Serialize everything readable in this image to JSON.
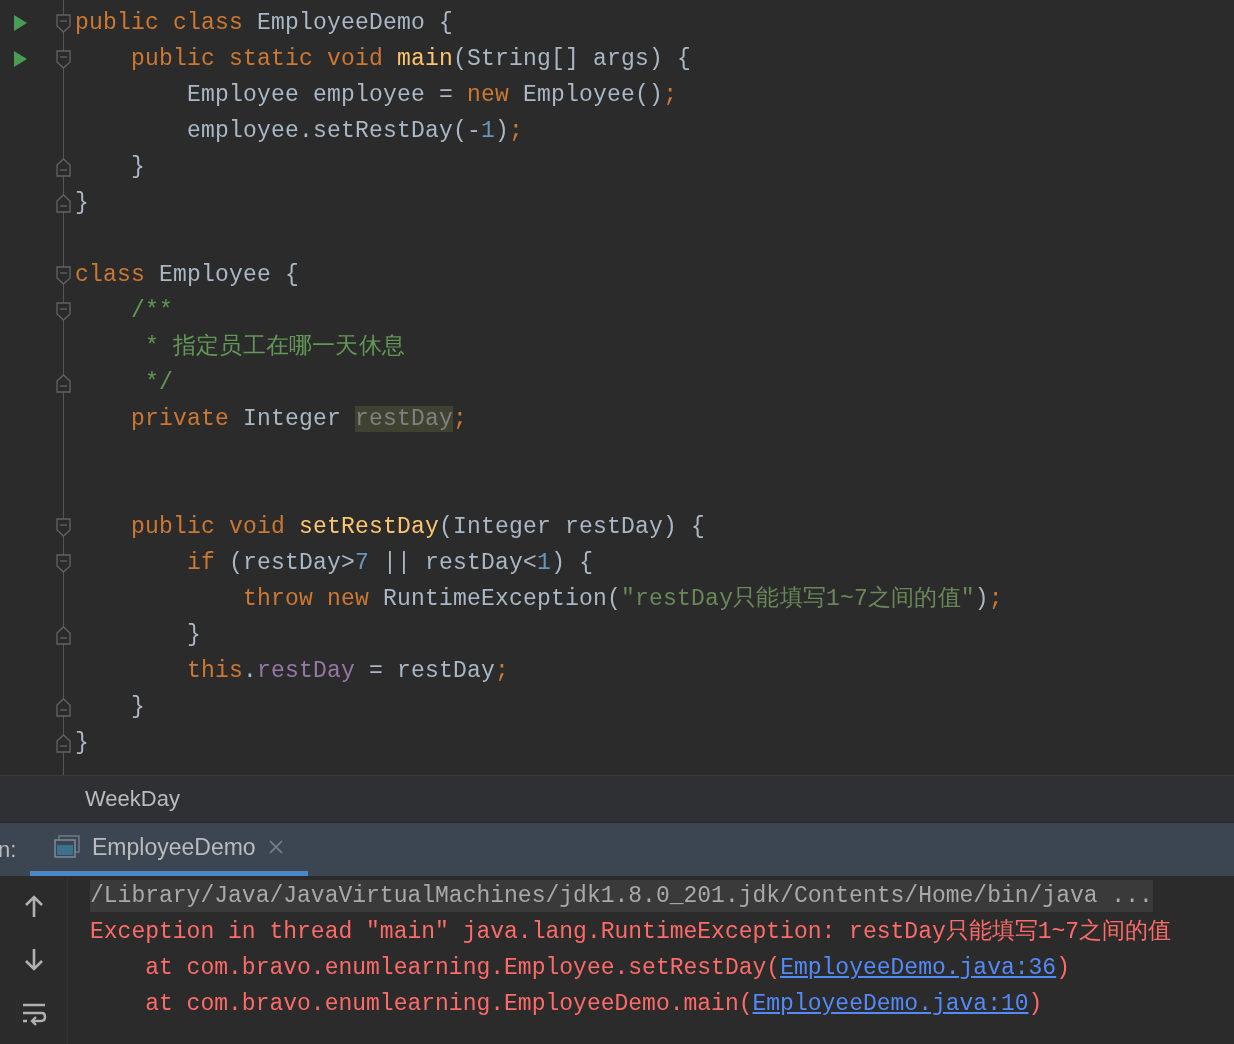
{
  "editor": {
    "lines": [
      {
        "run": true,
        "fold_start": true,
        "fold_end": false,
        "tokens": [
          {
            "kind": "keyword",
            "text": "public class "
          },
          {
            "kind": "plain",
            "text": "EmployeeDemo {"
          }
        ]
      },
      {
        "run": true,
        "fold_start": true,
        "fold_end": false,
        "tokens": [
          {
            "kind": "keyword",
            "text": "    public static void "
          },
          {
            "kind": "method",
            "text": "main"
          },
          {
            "kind": "plain",
            "text": "(String[] args) {"
          }
        ]
      },
      {
        "run": false,
        "fold_start": false,
        "fold_end": false,
        "tokens": [
          {
            "kind": "plain",
            "text": "        Employee employee = "
          },
          {
            "kind": "keyword",
            "text": "new "
          },
          {
            "kind": "plain",
            "text": "Employee()"
          },
          {
            "kind": "keyword",
            "text": ";"
          }
        ]
      },
      {
        "run": false,
        "fold_start": false,
        "fold_end": false,
        "tokens": [
          {
            "kind": "plain",
            "text": "        employee.setRestDay(-"
          },
          {
            "kind": "number",
            "text": "1"
          },
          {
            "kind": "plain",
            "text": ")"
          },
          {
            "kind": "keyword",
            "text": ";"
          }
        ]
      },
      {
        "run": false,
        "fold_start": false,
        "fold_end": true,
        "tokens": [
          {
            "kind": "plain",
            "text": "    }"
          }
        ]
      },
      {
        "run": false,
        "fold_start": false,
        "fold_end": true,
        "tokens": [
          {
            "kind": "plain",
            "text": "}"
          }
        ]
      },
      {
        "run": false,
        "fold_start": false,
        "fold_end": false
      },
      {
        "run": false,
        "fold_start": true,
        "fold_end": false,
        "tokens": [
          {
            "kind": "keyword",
            "text": "class "
          },
          {
            "kind": "plain",
            "text": "Employee {"
          }
        ]
      },
      {
        "run": false,
        "fold_start": true,
        "fold_end": false,
        "tokens": [
          {
            "kind": "comment",
            "text": "    /**"
          }
        ]
      },
      {
        "run": false,
        "fold_start": false,
        "fold_end": false,
        "tokens": [
          {
            "kind": "comment",
            "text": "     * 指定员工在哪一天休息"
          }
        ]
      },
      {
        "run": false,
        "fold_start": false,
        "fold_end": true,
        "tokens": [
          {
            "kind": "comment",
            "text": "     */"
          }
        ]
      },
      {
        "run": false,
        "fold_start": false,
        "fold_end": false,
        "tokens": [
          {
            "kind": "keyword",
            "text": "    private "
          },
          {
            "kind": "plain",
            "text": "Integer "
          },
          {
            "kind": "unused",
            "text": "restDay"
          },
          {
            "kind": "keyword",
            "text": ";"
          }
        ]
      },
      {
        "run": false,
        "fold_start": false,
        "fold_end": false
      },
      {
        "run": false,
        "fold_start": false,
        "fold_end": false
      },
      {
        "run": false,
        "fold_start": true,
        "fold_end": false,
        "tokens": [
          {
            "kind": "keyword",
            "text": "    public void "
          },
          {
            "kind": "method",
            "text": "setRestDay"
          },
          {
            "kind": "plain",
            "text": "(Integer restDay) {"
          }
        ]
      },
      {
        "run": false,
        "fold_start": true,
        "fold_end": false,
        "tokens": [
          {
            "kind": "keyword",
            "text": "        if "
          },
          {
            "kind": "plain",
            "text": "(restDay>"
          },
          {
            "kind": "number",
            "text": "7"
          },
          {
            "kind": "plain",
            "text": " || restDay<"
          },
          {
            "kind": "number",
            "text": "1"
          },
          {
            "kind": "plain",
            "text": ") {"
          }
        ]
      },
      {
        "run": false,
        "fold_start": false,
        "fold_end": false,
        "tokens": [
          {
            "kind": "keyword",
            "text": "            throw new "
          },
          {
            "kind": "plain",
            "text": "RuntimeException("
          },
          {
            "kind": "string",
            "text": "\"restDay只能填写1~7之间的值\""
          },
          {
            "kind": "plain",
            "text": ")"
          },
          {
            "kind": "keyword",
            "text": ";"
          }
        ]
      },
      {
        "run": false,
        "fold_start": false,
        "fold_end": true,
        "tokens": [
          {
            "kind": "plain",
            "text": "        }"
          }
        ]
      },
      {
        "run": false,
        "fold_start": false,
        "fold_end": false,
        "tokens": [
          {
            "kind": "keyword",
            "text": "        this"
          },
          {
            "kind": "plain",
            "text": "."
          },
          {
            "kind": "field",
            "text": "restDay"
          },
          {
            "kind": "plain",
            "text": " = restDay"
          },
          {
            "kind": "keyword",
            "text": ";"
          }
        ]
      },
      {
        "run": false,
        "fold_start": false,
        "fold_end": true,
        "tokens": [
          {
            "kind": "plain",
            "text": "    }"
          }
        ]
      },
      {
        "run": false,
        "fold_start": false,
        "fold_end": true,
        "tokens": [
          {
            "kind": "plain",
            "text": "}"
          }
        ]
      }
    ]
  },
  "breadcrumb": "WeekDay",
  "run_panel": {
    "label": "n:",
    "tabs": [
      {
        "label": "EmployeeDemo",
        "selected": true
      }
    ],
    "console": [
      {
        "kind": "command",
        "parts": [
          {
            "kind": "text",
            "text": "/Library/Java/JavaVirtualMachines/jdk1.8.0_201.jdk/Contents/Home/bin/java ..."
          }
        ]
      },
      {
        "kind": "error",
        "parts": [
          {
            "kind": "text",
            "text": "Exception in thread \"main\" java.lang.RuntimeException: restDay只能填写1~7之间的值"
          }
        ]
      },
      {
        "kind": "error",
        "parts": [
          {
            "kind": "text",
            "text": "    at com.bravo.enumlearning.Employee.setRestDay("
          },
          {
            "kind": "link",
            "text": "EmployeeDemo.java:36"
          },
          {
            "kind": "text",
            "text": ")"
          }
        ]
      },
      {
        "kind": "error",
        "parts": [
          {
            "kind": "text",
            "text": "    at com.bravo.enumlearning.EmployeeDemo.main("
          },
          {
            "kind": "link",
            "text": "EmployeeDemo.java:10"
          },
          {
            "kind": "text",
            "text": ")"
          }
        ]
      }
    ]
  }
}
